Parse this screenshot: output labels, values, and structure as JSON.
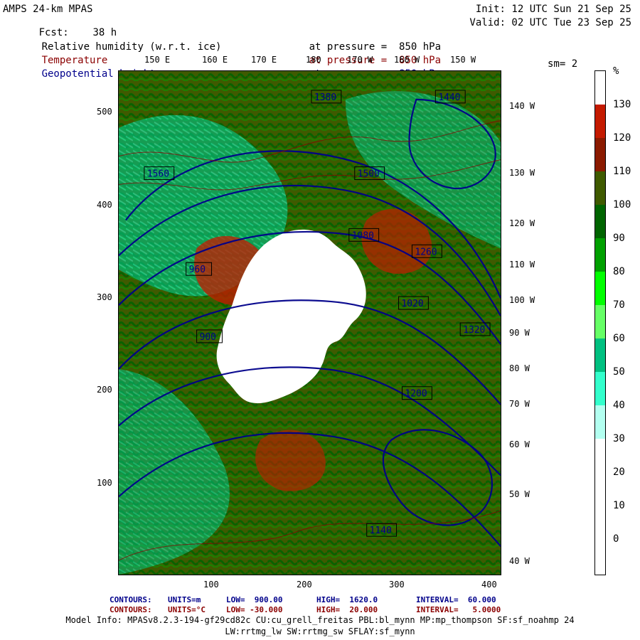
{
  "header": {
    "title_line1_left": "AMPS 24-km MPAS",
    "title_line2_left_label": "Fcst:",
    "title_line2_left_value": "38 h",
    "title_line1_right": "Init: 12 UTC Sun 21 Sep 25",
    "title_line2_right": "Valid: 02 UTC Tue 23 Sep 25"
  },
  "legend": {
    "line1": {
      "name": "Relative humidity (w.r.t. ice)",
      "level": "at pressure =  850 hPa"
    },
    "line2": {
      "name": "Temperature",
      "level": "at pressure =  850 hPa"
    },
    "line3": {
      "name": "Geopotential height",
      "level": "at pressure =  850 hPa"
    },
    "sm": "sm= 2",
    "unit": "%"
  },
  "axis_labels": {
    "y_ticks": [
      "500",
      "400",
      "300",
      "200",
      "100"
    ],
    "x_ticks": [
      "100",
      "200",
      "300",
      "400"
    ],
    "top_lon": [
      "150 E",
      "160 E",
      "170 E",
      "180",
      "170 W",
      "160 W",
      "150 W"
    ],
    "right_lon": [
      "140 W",
      "130 W",
      "120 W",
      "110 W",
      "100 W",
      "90 W",
      "80 W",
      "70 W",
      "60 W",
      "50 W",
      "40 W"
    ]
  },
  "colorbar": {
    "labels": [
      "130",
      "120",
      "110",
      "100",
      "90",
      "80",
      "70",
      "60",
      "50",
      "40",
      "30",
      "20",
      "10",
      "0"
    ],
    "colors": {
      "c130": "#ff0000",
      "c120": "#c41a00",
      "c110": "#8b1a00",
      "c100": "#3f5a00",
      "c90": "#006400",
      "c80": "#00a000",
      "c70": "#00ff00",
      "c60": "#66ff66",
      "c50": "#00c080",
      "c40": "#33ffcc",
      "c30": "#b3fff0",
      "c20": "#ffffff",
      "c10": "#ffffff",
      "c0": "#ffffff"
    }
  },
  "contours": {
    "line1": {
      "label": "CONTOURS:",
      "units": "UNITS=m",
      "low": "LOW=  900.00",
      "high": "HIGH=  1620.0",
      "interval": "INTERVAL=  60.000"
    },
    "line2": {
      "label": "CONTOURS:",
      "units": "UNITS=°C",
      "low": "LOW= -30.000",
      "high": "HIGH=  20.000",
      "interval": "INTERVAL=   5.0000"
    }
  },
  "model_info": {
    "line1": "Model Info: MPASv8.2.3-194-gf29cd82c CU:cu_grell_freitas PBL:bl_mynn MP:mp_thompson SF:sf_noahmp 24",
    "line2": "LW:rrtmg_lw SW:rrtmg_sw SFLAY:sf_mynn"
  },
  "map_labels": {
    "heights": [
      "1560",
      "1500",
      "1440",
      "1380",
      "1320",
      "1260",
      "1200",
      "1140",
      "1080",
      "1020",
      "960",
      "900"
    ]
  }
}
